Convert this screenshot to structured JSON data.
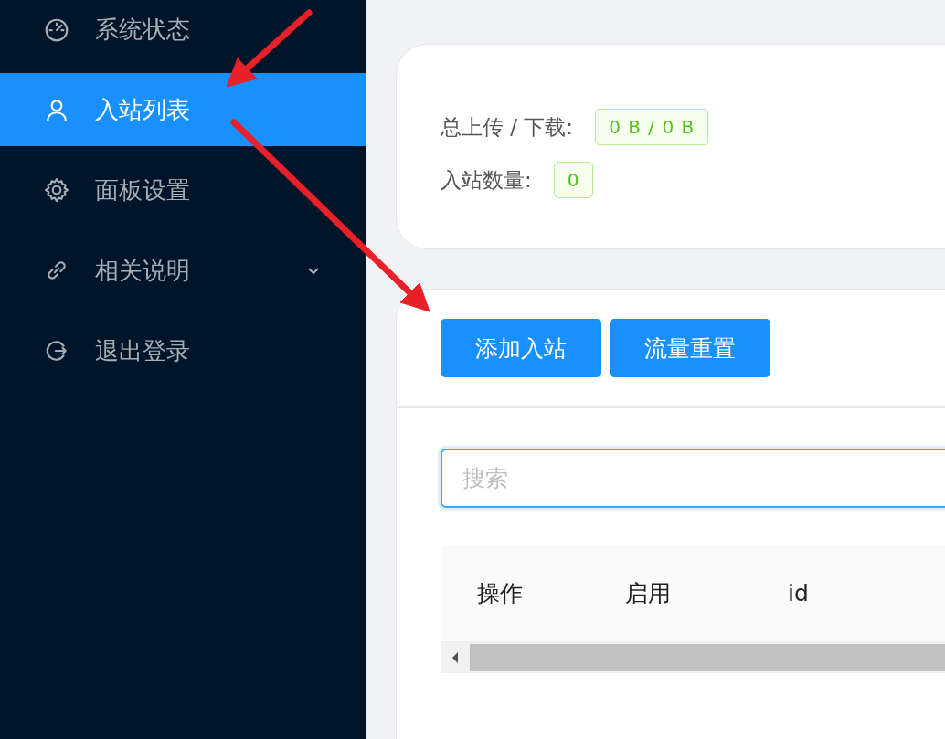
{
  "sidebar": {
    "items": [
      {
        "label": "系统状态",
        "selected": false,
        "kind": "item"
      },
      {
        "label": "入站列表",
        "selected": true,
        "kind": "item"
      },
      {
        "label": "面板设置",
        "selected": false,
        "kind": "item"
      },
      {
        "label": "相关说明",
        "selected": false,
        "kind": "submenu"
      },
      {
        "label": "退出登录",
        "selected": false,
        "kind": "item"
      }
    ]
  },
  "stats": [
    {
      "label": "总上传 / 下载:",
      "value": "0 B / 0 B"
    },
    {
      "label": "入站数量:",
      "value": "0"
    }
  ],
  "inbounds": {
    "buttons": [
      "添加入站",
      "流量重置"
    ],
    "search": {
      "placeholder": "搜索"
    },
    "table": {
      "columns": [
        "操作",
        "启用",
        "id"
      ]
    }
  }
}
